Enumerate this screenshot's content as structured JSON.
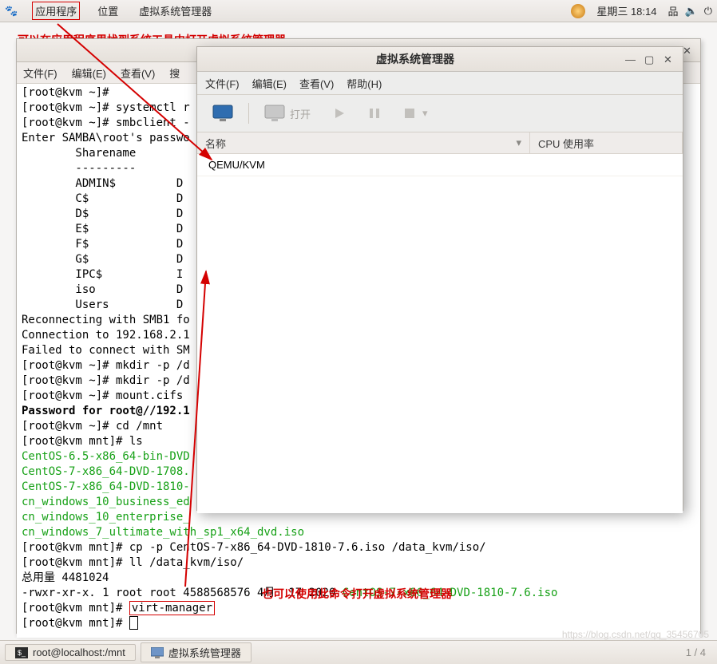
{
  "topbar": {
    "applications": "应用程序",
    "places": "位置",
    "vmm": "虚拟系统管理器",
    "datetime": "星期三 18:14"
  },
  "notes": {
    "top": "可以在应用程序里找到系统工具中打开虚拟系统管理器",
    "bottom": "也可以使用此命令打开虚拟系统管理器"
  },
  "term_window": {
    "title": "root@localhost:/mnt",
    "menu": {
      "file": "文件(F)",
      "edit": "编辑(E)",
      "view": "查看(V)",
      "search": "搜"
    }
  },
  "term_lines": [
    {
      "t": "[root@kvm ~]#"
    },
    {
      "t": "[root@kvm ~]# systemctl r"
    },
    {
      "t": "[root@kvm ~]# smbclient -"
    },
    {
      "t": "Enter SAMBA\\root's passwo"
    },
    {
      "t": ""
    },
    {
      "t": "        Sharename      "
    },
    {
      "t": "        ---------      "
    },
    {
      "t": "        ADMIN$         D"
    },
    {
      "t": "        C$             D"
    },
    {
      "t": "        D$             D"
    },
    {
      "t": "        E$             D"
    },
    {
      "t": "        F$             D"
    },
    {
      "t": "        G$             D"
    },
    {
      "t": "        IPC$           I"
    },
    {
      "t": "        iso            D"
    },
    {
      "t": "        Users          D"
    },
    {
      "t": "Reconnecting with SMB1 fo"
    },
    {
      "t": "Connection to 192.168.2.1"
    },
    {
      "t": "Failed to connect with SM"
    },
    {
      "t": "[root@kvm ~]# mkdir -p /d"
    },
    {
      "t": "[root@kvm ~]# mkdir -p /d"
    },
    {
      "t": "[root@kvm ~]# mount.cifs "
    },
    {
      "t": "Password for root@//192.1",
      "b": true
    },
    {
      "t": "[root@kvm ~]# cd /mnt"
    },
    {
      "t": "[root@kvm mnt]# ls"
    },
    {
      "t": "CentOS-6.5-x86_64-bin-DVD",
      "g": true
    },
    {
      "t": "CentOS-7-x86_64-DVD-1708.",
      "g": true
    },
    {
      "t": "CentOS-7-x86_64-DVD-1810-",
      "g": true
    },
    {
      "t": "cn_windows_10_business_ed",
      "g": true
    },
    {
      "t": "cn_windows_10_enterprise_",
      "g": true
    },
    {
      "t": "cn_windows_7_ultimate_with_sp1_x64_dvd.iso",
      "g": true
    },
    {
      "t": "[root@kvm mnt]# cp -p CentOS-7-x86_64-DVD-1810-7.6.iso /data_kvm/iso/"
    },
    {
      "t": "[root@kvm mnt]# ll /data_kvm/iso/"
    },
    {
      "t": "总用量 4481024"
    }
  ],
  "term_ls_line": {
    "prefix": "-rwxr-xr-x. 1 root root 4588568576 4月  17 2020 ",
    "file": "CentOS-7-x86_64-DVD-1810-7.6.iso"
  },
  "term_cmd_line": {
    "prefix": "[root@kvm mnt]# ",
    "cmd": "virt-manager"
  },
  "term_prompt": "[root@kvm mnt]# ",
  "vmm": {
    "title": "虚拟系统管理器",
    "menu": {
      "file": "文件(F)",
      "edit": "编辑(E)",
      "view": "查看(V)",
      "help": "帮助(H)"
    },
    "toolbar": {
      "open": "打开"
    },
    "cols": {
      "name": "名称",
      "cpu": "CPU 使用率"
    },
    "rows": [
      {
        "name": "QEMU/KVM"
      }
    ]
  },
  "taskbar": {
    "term": "root@localhost:/mnt",
    "vmm": "虚拟系统管理器",
    "pager": "1  /  4"
  },
  "watermark": "https://blog.csdn.net/qq_35456705"
}
